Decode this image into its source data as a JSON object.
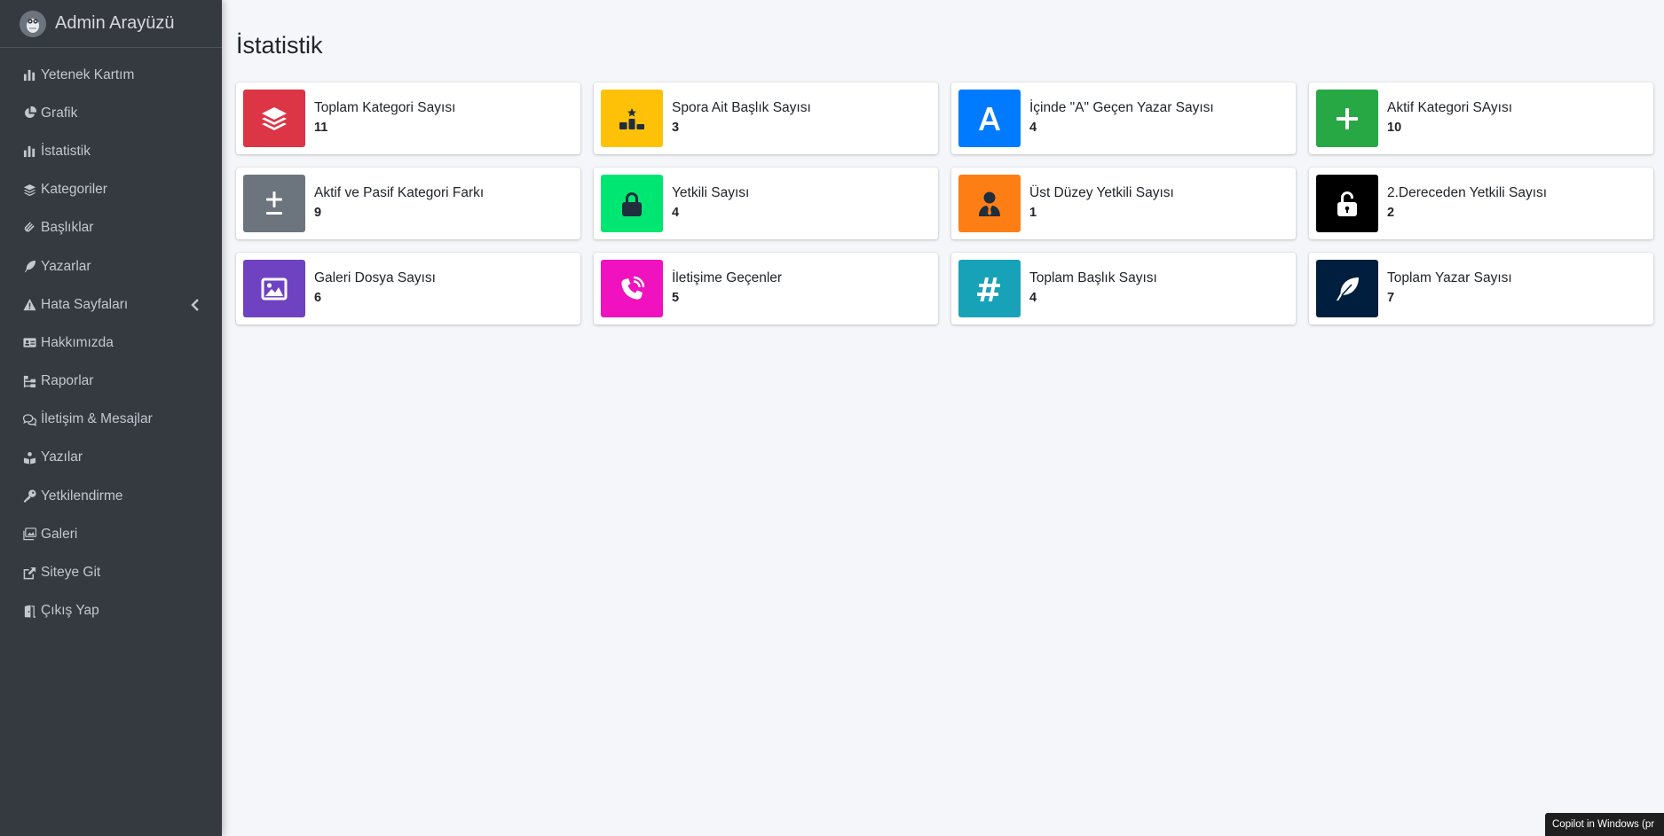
{
  "brand": {
    "title": "Admin Arayüzü"
  },
  "sidebar": {
    "items": [
      {
        "label": "Yetenek Kartım",
        "icon": "bar-chart-icon"
      },
      {
        "label": "Grafik",
        "icon": "pie-chart-icon"
      },
      {
        "label": "İstatistik",
        "icon": "bar-chart-icon"
      },
      {
        "label": "Kategoriler",
        "icon": "layers-icon"
      },
      {
        "label": "Başlıklar",
        "icon": "paperclip-icon"
      },
      {
        "label": "Yazarlar",
        "icon": "feather-icon"
      },
      {
        "label": "Hata Sayfaları",
        "icon": "warning-icon"
      },
      {
        "label": "Hakkımızda",
        "icon": "id-card-icon"
      },
      {
        "label": "Raporlar",
        "icon": "sitemap-icon"
      },
      {
        "label": "İletişim & Mesajlar",
        "icon": "comments-icon"
      },
      {
        "label": "Yazılar",
        "icon": "book-reader-icon"
      },
      {
        "label": "Yetkilendirme",
        "icon": "key-icon"
      },
      {
        "label": "Galeri",
        "icon": "images-icon"
      },
      {
        "label": "Siteye Git",
        "icon": "external-link-icon"
      },
      {
        "label": "Çıkış Yap",
        "icon": "door-open-icon"
      }
    ]
  },
  "main": {
    "title": "İstatistik",
    "cards": [
      {
        "label": "Toplam Kategori Sayısı",
        "value": "11",
        "color": "#dc3545",
        "icon": "layers-icon"
      },
      {
        "label": "Spora Ait Başlık Sayısı",
        "value": "3",
        "color": "#ffc107",
        "icon": "podium-icon"
      },
      {
        "label": "İçinde \"A\" Geçen Yazar Sayısı",
        "value": "4",
        "color": "#007bff",
        "icon": "letter-a-icon"
      },
      {
        "label": "Aktif Kategori SAyısı",
        "value": "10",
        "color": "#28a745",
        "icon": "plus-icon"
      },
      {
        "label": "Aktif ve Pasif Kategori Farkı",
        "value": "9",
        "color": "#6c757d",
        "icon": "plus-minus-icon"
      },
      {
        "label": "Yetkili Sayısı",
        "value": "4",
        "color": "#00e672",
        "icon": "lock-icon"
      },
      {
        "label": "Üst Düzey Yetkili Sayısı",
        "value": "1",
        "color": "#fd7e14",
        "icon": "user-tie-icon"
      },
      {
        "label": "2.Dereceden Yetkili Sayısı",
        "value": "2",
        "color": "#000000",
        "icon": "lock-open-icon"
      },
      {
        "label": "Galeri Dosya Sayısı",
        "value": "6",
        "color": "#6f42c1",
        "icon": "image-icon"
      },
      {
        "label": "İletişime Geçenler",
        "value": "5",
        "color": "#f012be",
        "icon": "phone-volume-icon"
      },
      {
        "label": "Toplam Başlık Sayısı",
        "value": "4",
        "color": "#17a2b8",
        "icon": "hashtag-icon"
      },
      {
        "label": "Toplam Yazar Sayısı",
        "value": "7",
        "color": "#001f3f",
        "icon": "feather-icon"
      }
    ]
  },
  "taskbar": {
    "copilot_label": "Copilot in Windows (pr"
  }
}
